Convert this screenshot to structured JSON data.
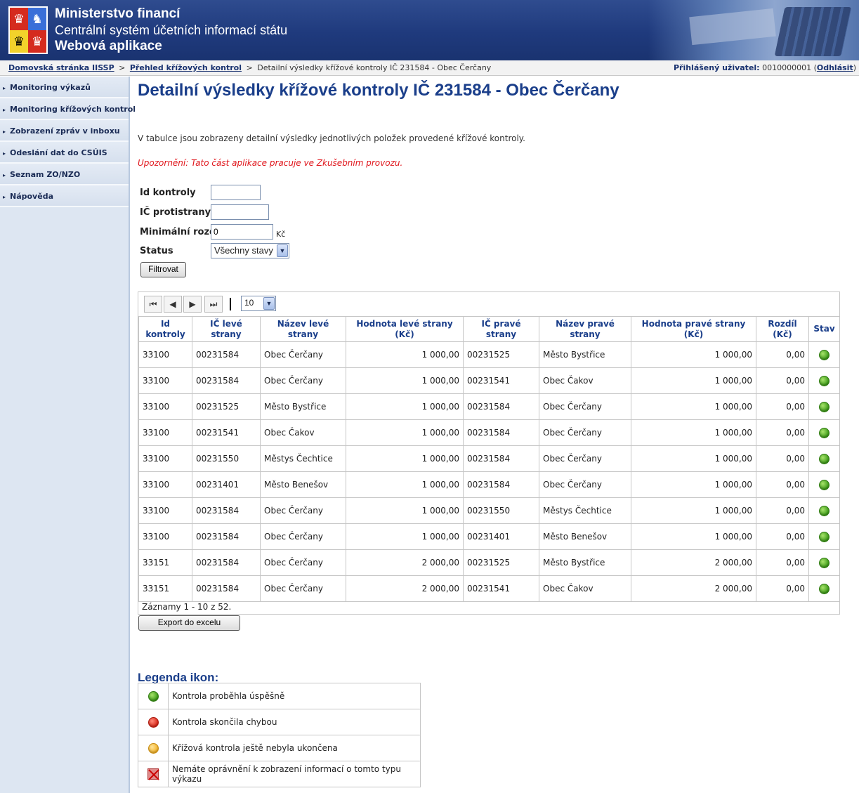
{
  "header": {
    "line1": "Ministerstvo financí",
    "line2": "Centrální systém účetních informací státu",
    "line3": "Webová aplikace"
  },
  "breadcrumb": {
    "items": [
      "Domovská stránka IISSP",
      "Přehled křížových kontrol"
    ],
    "separator": ">",
    "current": "Detailní výsledky křížové kontroly IČ 231584 - Obec Čerčany"
  },
  "user": {
    "label": "Přihlášený uživatel:",
    "id": "0010000001",
    "logout": "Odhlásit"
  },
  "sidebar": {
    "items": [
      {
        "label": "Monitoring výkazů"
      },
      {
        "label": "Monitoring křížových kontrol"
      },
      {
        "label": "Zobrazení zpráv v inboxu"
      },
      {
        "label": "Odeslání dat do CSÚIS"
      },
      {
        "label": "Seznam ZO/NZO"
      },
      {
        "label": "Nápověda"
      }
    ]
  },
  "page": {
    "title": "Detailní výsledky křížové kontroly IČ 231584 - Obec Čerčany",
    "description": "V tabulce jsou zobrazeny detailní výsledky jednotlivých položek provedené křížové kontroly.",
    "warning": "Upozornění: Tato část aplikace pracuje ve Zkušebním provozu."
  },
  "filter": {
    "id_label": "Id kontroly",
    "id_value": "",
    "ic_label": "IČ protistrany",
    "ic_value": "",
    "min_label": "Minimální rozdíl",
    "min_value": "0",
    "min_unit": "Kč",
    "status_label": "Status",
    "status_value": "Všechny stavy",
    "submit": "Filtrovat"
  },
  "pager": {
    "page_size": "10"
  },
  "table": {
    "columns": [
      "Id kontroly",
      "IČ levé strany",
      "Název levé strany",
      "Hodnota levé strany (Kč)",
      "IČ pravé strany",
      "Název pravé strany",
      "Hodnota pravé strany (Kč)",
      "Rozdíl (Kč)",
      "Stav"
    ],
    "rows": [
      [
        "33100",
        "00231584",
        "Obec Čerčany",
        "1 000,00",
        "00231525",
        "Město Bystřice",
        "1 000,00",
        "0,00",
        "green"
      ],
      [
        "33100",
        "00231584",
        "Obec Čerčany",
        "1 000,00",
        "00231541",
        "Obec Čakov",
        "1 000,00",
        "0,00",
        "green"
      ],
      [
        "33100",
        "00231525",
        "Město Bystřice",
        "1 000,00",
        "00231584",
        "Obec Čerčany",
        "1 000,00",
        "0,00",
        "green"
      ],
      [
        "33100",
        "00231541",
        "Obec Čakov",
        "1 000,00",
        "00231584",
        "Obec Čerčany",
        "1 000,00",
        "0,00",
        "green"
      ],
      [
        "33100",
        "00231550",
        "Městys Čechtice",
        "1 000,00",
        "00231584",
        "Obec Čerčany",
        "1 000,00",
        "0,00",
        "green"
      ],
      [
        "33100",
        "00231401",
        "Město Benešov",
        "1 000,00",
        "00231584",
        "Obec Čerčany",
        "1 000,00",
        "0,00",
        "green"
      ],
      [
        "33100",
        "00231584",
        "Obec Čerčany",
        "1 000,00",
        "00231550",
        "Městys Čechtice",
        "1 000,00",
        "0,00",
        "green"
      ],
      [
        "33100",
        "00231584",
        "Obec Čerčany",
        "1 000,00",
        "00231401",
        "Město Benešov",
        "1 000,00",
        "0,00",
        "green"
      ],
      [
        "33151",
        "00231584",
        "Obec Čerčany",
        "2 000,00",
        "00231525",
        "Město Bystřice",
        "2 000,00",
        "0,00",
        "green"
      ],
      [
        "33151",
        "00231584",
        "Obec Čerčany",
        "2 000,00",
        "00231541",
        "Obec Čakov",
        "2 000,00",
        "0,00",
        "green"
      ]
    ],
    "records": "Záznamy 1 - 10 z 52."
  },
  "export_button": "Export do excelu",
  "legend": {
    "title": "Legenda ikon:",
    "items": [
      {
        "icon": "green-dot-icon",
        "text": "Kontrola proběhla úspěšně"
      },
      {
        "icon": "red-dot-icon",
        "text": "Kontrola skončila chybou"
      },
      {
        "icon": "yellow-dot-icon",
        "text": "Křížová kontrola ještě nebyla ukončena"
      },
      {
        "icon": "no-access-icon",
        "text": "Nemáte oprávnění k zobrazení informací o tomto typu výkazu"
      }
    ]
  },
  "colors": {
    "header_bg": "#1f3a7d",
    "title": "#1a3e8a",
    "warning": "#e0151b",
    "status_ok": "#3d9b18"
  }
}
